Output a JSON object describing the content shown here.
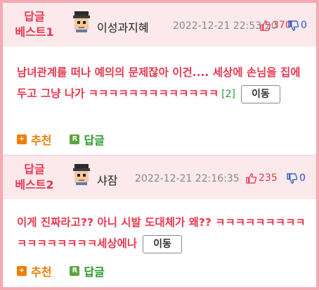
{
  "colors": {
    "accent": "#e8384f",
    "border": "#f6a8b3",
    "header_bg": "#fbe9ec",
    "recommend": "#ef7d00",
    "reply": "#2a9a2a",
    "dislike": "#2257c9"
  },
  "posts": [
    {
      "badge_line1": "답글",
      "badge_line2": "베스트1",
      "nickname": "이성과지혜",
      "date": "2022-12-21 22:53:20",
      "likes": "370",
      "dislikes": "0",
      "content": "남녀관계를 떠나 예의의 문제잖아 이건.... 세상에 손님을 집에 두고 그냥 나가 ㅋㅋㅋㅋㅋㅋㅋㅋㅋㅋㅋㅋㅋ",
      "reply_count": "[2]",
      "move_label": "이동",
      "recommend_label": "추천",
      "reply_label": "답글",
      "avatar_icon": "pixel-face-avatar"
    },
    {
      "badge_line1": "답글",
      "badge_line2": "베스트2",
      "nickname": "샤잠",
      "date": "2022-12-21 22:16:35",
      "likes": "235",
      "dislikes": "0",
      "content": "이게 진짜라고?? 아니 시발 도대체가 왜?? ㅋㅋㅋㅋㅋㅋㅋㅋㅋㅋㅋㅋㅋㅋㅋㅋㅋ세상에나",
      "move_label": "이동",
      "recommend_label": "추천",
      "reply_label": "답글",
      "avatar_icon": "pixel-face-avatar"
    }
  ]
}
